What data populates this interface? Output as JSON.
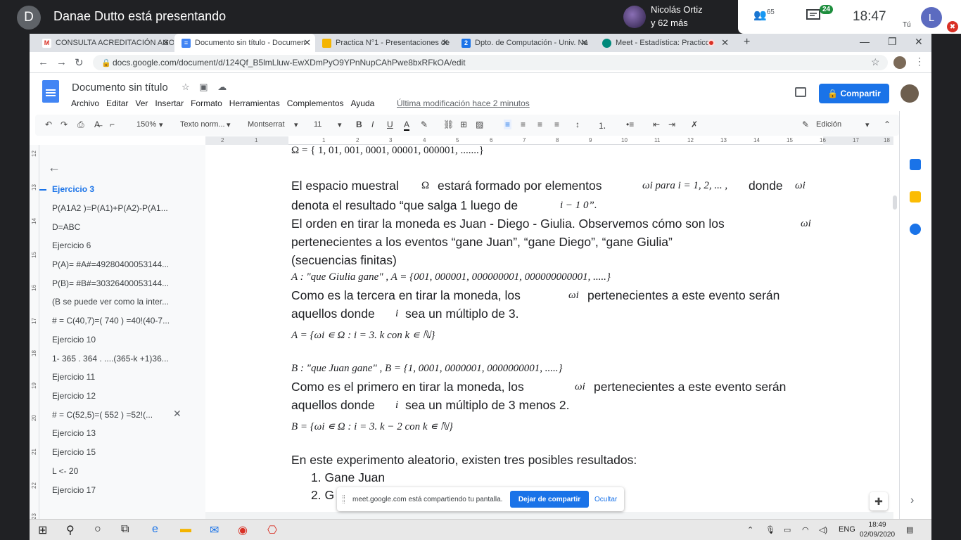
{
  "meet": {
    "presenter_initial": "D",
    "presenting_text": "Danae Dutto está presentando",
    "participant_name": "Nicolás Ortiz",
    "participant_more": "y 62 más",
    "people_count": "65",
    "chat_badge": "24",
    "time": "18:47",
    "self_initial": "L",
    "self_label": "Tú"
  },
  "browser": {
    "tabs": [
      {
        "label": "CONSULTA ACREDITACIÓN AGO",
        "icon": "gmail-icon",
        "color": "#d93025"
      },
      {
        "label": "Documento sin título - Documen",
        "icon": "docs-icon",
        "color": "#4285f4"
      },
      {
        "label": "Practica N°1 - Presentaciones de",
        "icon": "slides-icon",
        "color": "#f4b400"
      },
      {
        "label": "Dpto. de Computación - Univ. Na",
        "icon": "site-icon",
        "color": "#1a73e8"
      },
      {
        "label": "Meet - Estadística: Practico",
        "icon": "meet-icon",
        "color": "#00897b"
      }
    ],
    "url": "docs.google.com/document/d/124Qf_B5lmLluw-EwXDmPyO9YPnNupCAhPwe8bxRFkOA/edit"
  },
  "docs": {
    "title": "Documento sin título",
    "menu": [
      "Archivo",
      "Editar",
      "Ver",
      "Insertar",
      "Formato",
      "Herramientas",
      "Complementos",
      "Ayuda"
    ],
    "last_modified": "Última modificación hace 2 minutos",
    "share_label": "Compartir",
    "toolbar": {
      "zoom": "150%",
      "style": "Texto norm...",
      "font": "Montserrat",
      "size": "11",
      "mode": "Edición"
    },
    "ruler_numbers": [
      "2",
      "1",
      "1",
      "2",
      "3",
      "4",
      "5",
      "6",
      "7",
      "8",
      "9",
      "10",
      "11",
      "12",
      "13",
      "14",
      "15",
      "16",
      "17",
      "18"
    ],
    "vruler_numbers": [
      "12",
      "13",
      "14",
      "15",
      "16",
      "17",
      "18",
      "19",
      "20",
      "21",
      "22",
      "23"
    ]
  },
  "outline": [
    {
      "label": "Ejercicio 3",
      "active": true
    },
    {
      "label": "P(A1A2 )=P(A1)+P(A2)-P(A1...",
      "active": false
    },
    {
      "label": "D=ABC",
      "active": false
    },
    {
      "label": "Ejercicio 6",
      "active": false
    },
    {
      "label": "P(A)= #A#=49280400053144...",
      "active": false
    },
    {
      "label": "P(B)= #B#=30326400053144...",
      "active": false
    },
    {
      "label": "(B se puede ver como la inter...",
      "active": false
    },
    {
      "label": "# = C(40,7)=( 740 ) =40!(40-7...",
      "active": false
    },
    {
      "label": "Ejercicio 10",
      "active": false
    },
    {
      "label": "1- 365 . 364 . ....(365-k +1)36...",
      "active": false
    },
    {
      "label": "Ejercicio 11",
      "active": false
    },
    {
      "label": "Ejercicio 12",
      "active": false
    },
    {
      "label": "# = C(52,5)=( 552 ) =52!(...",
      "active": false
    },
    {
      "label": "Ejercicio 13",
      "active": false
    },
    {
      "label": "Ejercicio 15",
      "active": false
    },
    {
      "label": "L <- 20",
      "active": false
    },
    {
      "label": "Ejercicio 17",
      "active": false
    }
  ],
  "content": {
    "omega_line": "Ω = { 1, 01, 001, 0001, 00001, 000001,  .......}",
    "p1_a": "El espacio muestral",
    "p1_omega": "Ω",
    "p1_b": "estará formado por elementos",
    "p1_math": "ωi  para i = 1, 2, ... ,",
    "p1_c": "donde",
    "p1_omega_i": "ωi",
    "p2": "denota el resultado “que salga 1 luego de",
    "p2_math": "i − 1  0”.",
    "p3": "El orden en tirar la moneda es Juan - Diego - Giulia. Observemos cómo son los",
    "p3_math": "ωi",
    "p4": "pertenecientes a los eventos “gane Juan”, “gane Diego”, “gane Giulia”",
    "p5": "(secuencias finitas)",
    "a_def": "A : \"que Giulia gane\" ,  A = {001, 000001, 000000001, 000000000001, .....}",
    "p6_a": "Como es la tercera en tirar la moneda,  los",
    "p6_math": "ωi",
    "p6_b": "pertenecientes a este evento serán",
    "p7_a": "aquellos donde",
    "p7_math": "i",
    "p7_b": "sea un múltiplo de 3.",
    "a_set": "A = {ωi ∊ Ω  :  i = 3. k  con k ∊ ℕ}",
    "b_def": "B : \"que Juan  gane\" ,  B = {1, 0001, 0000001, 0000000001, .....}",
    "p8_a": "Como es el primero en tirar la moneda,  los",
    "p8_math": "ωi",
    "p8_b": "pertenecientes a este evento serán",
    "p9_a": "aquellos donde",
    "p9_math": "i",
    "p9_b": "sea un múltiplo de 3 menos 2.",
    "b_set": "B = {ωi ∊ Ω  :  i = 3. k  − 2  con k ∊ ℕ}",
    "p10": "En este experimento aleatorio, existen tres posibles resultados:",
    "list": [
      "1.    Gane Juan",
      "2.    G"
    ]
  },
  "snackbar": {
    "message": "meet.google.com está compartiendo tu pantalla.",
    "stop_label": "Dejar de compartir",
    "hide_label": "Ocultar"
  },
  "taskbar": {
    "lang": "ENG",
    "time": "18:49",
    "date": "02/09/2020"
  }
}
